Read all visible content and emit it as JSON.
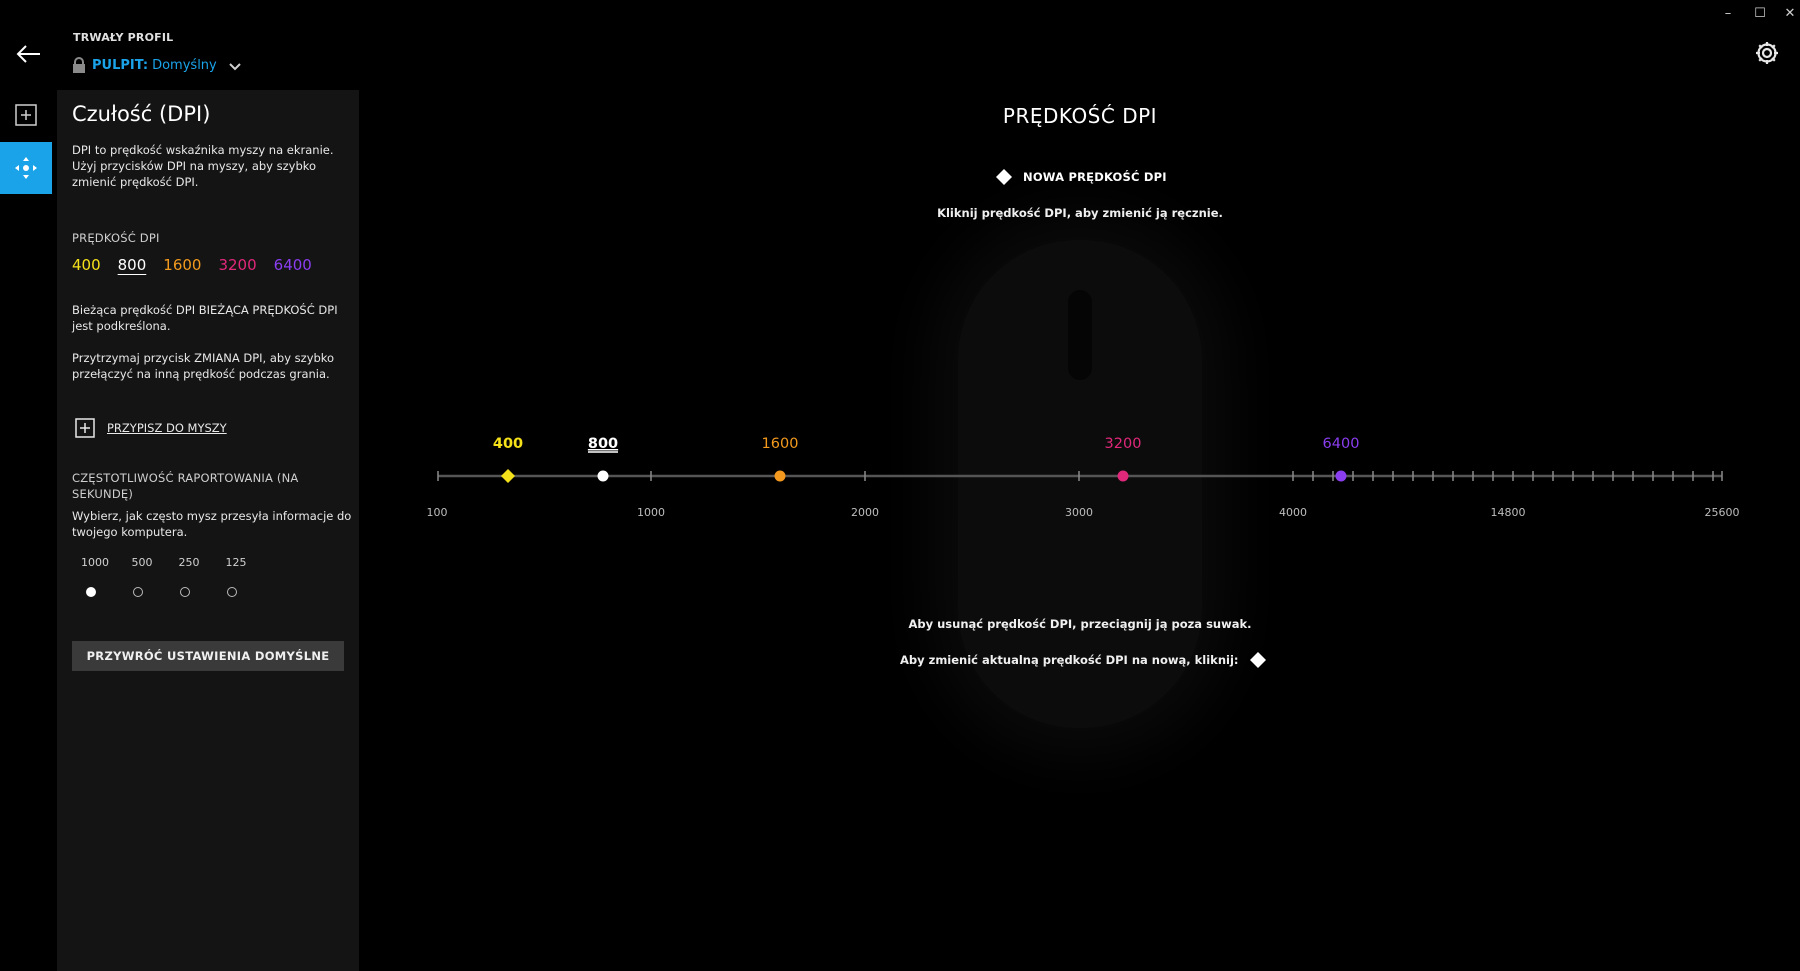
{
  "window": {
    "minimize": "–",
    "maximize": "☐",
    "close": "✕"
  },
  "header": {
    "back_icon": "arrow-left-icon",
    "profile_label": "TRWAŁY PROFIL",
    "profile_prefix": "PULPIT:",
    "profile_name": "Domyślny",
    "settings_icon": "gear-icon"
  },
  "panel": {
    "title": "Czułość (DPI)",
    "description": "DPI to prędkość wskaźnika myszy na ekranie. Użyj przycisków DPI na myszy, aby szybko zmienić prędkość DPI.",
    "dpi_section_label": "PRĘDKOŚĆ DPI",
    "dpi_values": [
      {
        "value": "400",
        "color": "#f5e11a"
      },
      {
        "value": "800",
        "color": "#ffffff",
        "current": true
      },
      {
        "value": "1600",
        "color": "#f39a1e"
      },
      {
        "value": "3200",
        "color": "#e0287a"
      },
      {
        "value": "6400",
        "color": "#8a3ef0"
      }
    ],
    "current_note": "Bieżąca prędkość DPI BIEŻĄCA PRĘDKOŚĆ DPI jest podkreślona.",
    "hold_note": "Przytrzymaj przycisk ZMIANA DPI, aby szybko przełączyć na inną prędkość podczas grania.",
    "assign_label": "PRZYPISZ DO MYSZY",
    "report_label": "CZĘSTOTLIWOŚĆ RAPORTOWANIA (NA SEKUNDĘ)",
    "report_desc": "Wybierz, jak często mysz przesyła informacje do twojego komputera.",
    "report_rates": [
      "1000",
      "500",
      "250",
      "125"
    ],
    "report_selected": "1000",
    "reset_label": "PRZYWRÓĆ USTAWIENIA DOMYŚLNE"
  },
  "main": {
    "title": "PRĘDKOŚĆ DPI",
    "new_dpi_label": "NOWA PRĘDKOŚĆ DPI",
    "click_hint": "Kliknij prędkość DPI, aby zmienić ją ręcznie.",
    "remove_hint": "Aby usunąć prędkość DPI, przeciągnij ją poza suwak.",
    "swap_hint": "Aby zmienić aktualną prędkość DPI na nową, kliknij:",
    "slider": {
      "axis_labels": [
        "100",
        "1000",
        "2000",
        "3000",
        "4000",
        "14800",
        "25600"
      ],
      "markers": [
        {
          "value": "400",
          "color": "#f5e11a",
          "shape": "diamond"
        },
        {
          "value": "800",
          "color": "#ffffff",
          "shape": "circle",
          "current": true
        },
        {
          "value": "1600",
          "color": "#f39a1e",
          "shape": "circle"
        },
        {
          "value": "3200",
          "color": "#e0287a",
          "shape": "circle"
        },
        {
          "value": "6400",
          "color": "#8a3ef0",
          "shape": "circle"
        }
      ]
    }
  },
  "colors": {
    "accent": "#1aa3e8",
    "panel_bg": "#141414"
  }
}
